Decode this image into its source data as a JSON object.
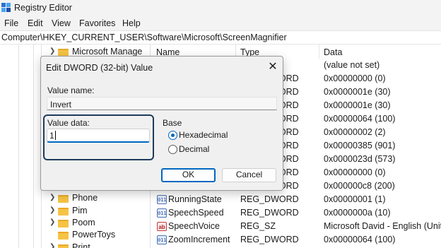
{
  "window": {
    "title": "Registry Editor"
  },
  "menu": [
    "File",
    "Edit",
    "View",
    "Favorites",
    "Help"
  ],
  "address": "Computer\\HKEY_CURRENT_USER\\Software\\Microsoft\\ScreenMagnifier",
  "tree": {
    "top_item": "Microsoft Manage",
    "bottom_items": [
      "Phone",
      "Pim",
      "Poom",
      "PowerToys",
      "Print"
    ]
  },
  "columns": {
    "name": "Name",
    "type": "Type",
    "data": "Data"
  },
  "values": [
    {
      "name": "",
      "type": "",
      "data": "(value not set)",
      "icon": ""
    },
    {
      "name": "",
      "type": "REG_DWORD",
      "data": "0x00000000 (0)",
      "icon": ""
    },
    {
      "name": "",
      "type": "REG_DWORD",
      "data": "0x0000001e (30)",
      "icon": ""
    },
    {
      "name": "",
      "type": "REG_DWORD",
      "data": "0x0000001e (30)",
      "icon": ""
    },
    {
      "name": "",
      "type": "REG_DWORD",
      "data": "0x00000064 (100)",
      "icon": ""
    },
    {
      "name": "",
      "type": "REG_DWORD",
      "data": "0x00000002 (2)",
      "icon": ""
    },
    {
      "name": "",
      "type": "REG_DWORD",
      "data": "0x00000385 (901)",
      "icon": ""
    },
    {
      "name": "",
      "type": "REG_DWORD",
      "data": "0x0000023d (573)",
      "icon": ""
    },
    {
      "name": "",
      "type": "REG_DWORD",
      "data": "0x00000000 (0)",
      "icon": ""
    },
    {
      "name": "",
      "type": "REG_DWORD",
      "data": "0x000000c8 (200)",
      "icon": ""
    },
    {
      "name": "RunningState",
      "type": "REG_DWORD",
      "data": "0x00000001 (1)",
      "icon": "dword"
    },
    {
      "name": "SpeechSpeed",
      "type": "REG_DWORD",
      "data": "0x0000000a (10)",
      "icon": "dword"
    },
    {
      "name": "SpeechVoice",
      "type": "REG_SZ",
      "data": "Microsoft David - English (United",
      "icon": "sz"
    },
    {
      "name": "ZoomIncrement",
      "type": "REG_DWORD",
      "data": "0x00000064 (100)",
      "icon": "dword"
    }
  ],
  "icon_glyphs": {
    "dword": "011",
    "sz": "ab"
  },
  "dialog": {
    "title": "Edit DWORD (32-bit) Value",
    "close_glyph": "✕",
    "value_name_label": "Value name:",
    "value_name": "Invert",
    "value_data_label": "Value data:",
    "value_data": "1",
    "base_label": "Base",
    "base_options": [
      {
        "label": "Hexadecimal",
        "selected": true
      },
      {
        "label": "Decimal",
        "selected": false
      }
    ],
    "ok_label": "OK",
    "cancel_label": "Cancel"
  },
  "colors": {
    "accent": "#0067c0",
    "highlight_border": "#1f3a5c",
    "folder": "#f6c344"
  }
}
